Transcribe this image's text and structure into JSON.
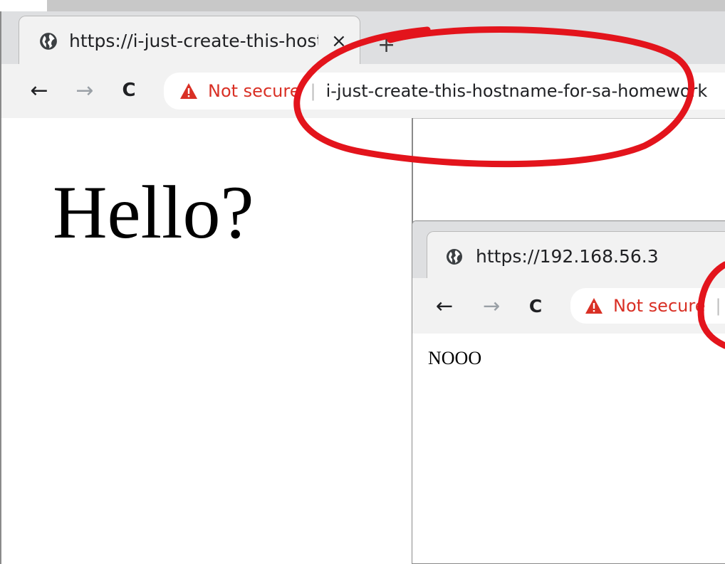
{
  "browser_a": {
    "tab_title": "https://i-just-create-this-hostname-for-sa-homework",
    "tab_close": "×",
    "new_tab": "+",
    "back": "←",
    "forward": "→",
    "reload": "C",
    "security_label": "Not secure",
    "separator": "|",
    "url": "i-just-create-this-hostname-for-sa-homework",
    "page_text": "Hello?"
  },
  "browser_b": {
    "tab_title": "https://192.168.56.3",
    "back": "←",
    "forward": "→",
    "reload": "C",
    "security_label": "Not secure",
    "separator": "|",
    "page_text": "NOOO"
  },
  "colors": {
    "annotation": "#e3141c",
    "warning": "#d93025",
    "chrome_bg": "#dedfe1"
  }
}
